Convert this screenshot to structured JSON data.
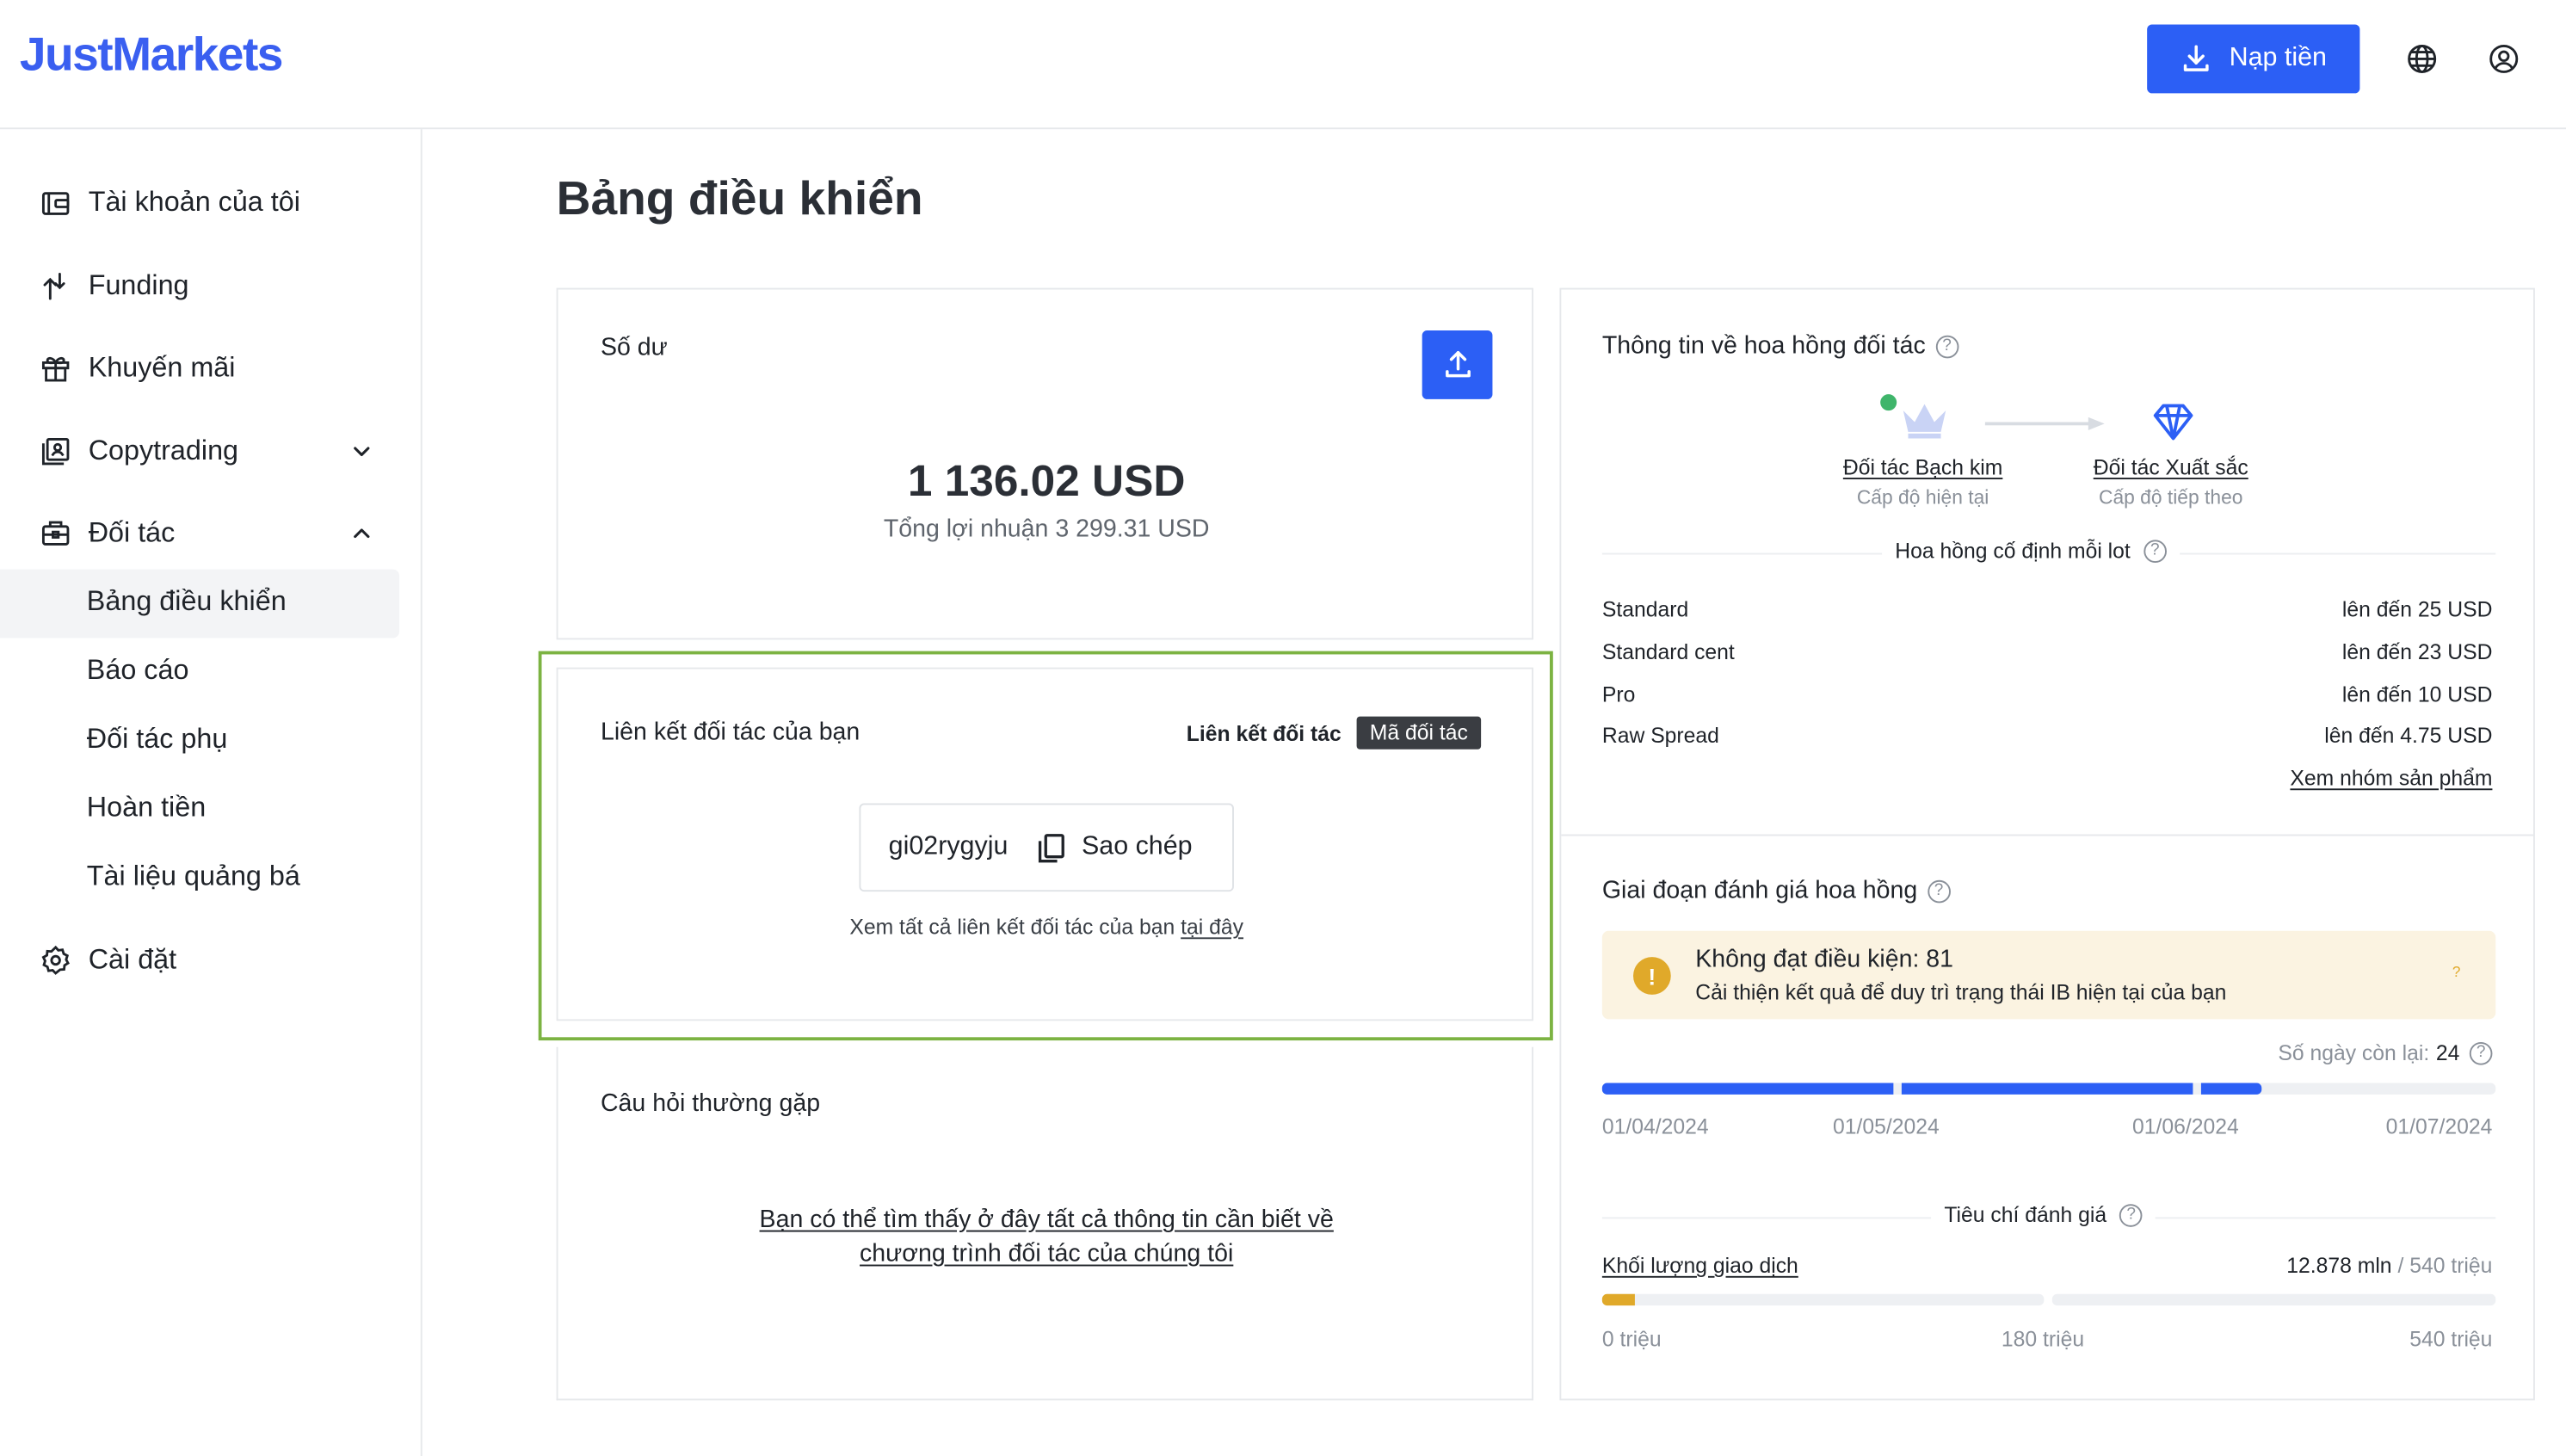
{
  "header": {
    "logo": "JustMarkets",
    "deposit_label": "Nạp tiền"
  },
  "sidebar": {
    "items": [
      {
        "label": "Tài khoản của tôi",
        "icon": "wallet-icon"
      },
      {
        "label": "Funding",
        "icon": "funding-icon"
      },
      {
        "label": "Khuyến mãi",
        "icon": "gift-icon"
      },
      {
        "label": "Copytrading",
        "icon": "copytrading-icon"
      },
      {
        "label": "Đối tác",
        "icon": "briefcase-icon"
      },
      {
        "label": "Cài đặt",
        "icon": "gear-icon"
      }
    ],
    "partner_sub": [
      "Bảng điều khiển",
      "Báo cáo",
      "Đối tác phụ",
      "Hoàn tiền",
      "Tài liệu quảng bá"
    ]
  },
  "page": {
    "title": "Bảng điều khiển"
  },
  "balance": {
    "label": "Số dư",
    "amount": "1 136.02 USD",
    "total_profit": "Tổng lợi nhuận 3 299.31 USD"
  },
  "partner_link": {
    "title": "Liên kết đối tác của bạn",
    "toggle_link": "Liên kết đối tác",
    "toggle_code": "Mã đối tác",
    "code": "gi02rygyju",
    "copy_label": "Sao chép",
    "see_all_prefix": "Xem tất cả liên kết đối tác của bạn",
    "see_all_link": "tại đây"
  },
  "faq": {
    "title": "Câu hỏi thường gặp",
    "line1": "Bạn có thể tìm thấy ở đây tất cả thông tin cần biết về",
    "line2": "chương trình đối tác của chúng tôi"
  },
  "commission": {
    "title": "Thông tin về hoa hồng đối tác",
    "current_level": "Đối tác Bạch kim",
    "current_caption": "Cấp độ hiện tại",
    "next_level": "Đối tác Xuất sắc",
    "next_caption": "Cấp độ tiếp theo",
    "fixed_title": "Hoa hồng cố định mỗi lot",
    "rows": [
      {
        "name": "Standard",
        "value": "lên đến 25 USD"
      },
      {
        "name": "Standard cent",
        "value": "lên đến 23 USD"
      },
      {
        "name": "Pro",
        "value": "lên đến 10 USD"
      },
      {
        "name": "Raw Spread",
        "value": "lên đến 4.75 USD"
      }
    ],
    "view_group": "Xem nhóm sản phẩm"
  },
  "evaluation": {
    "title": "Giai đoạn đánh giá hoa hồng",
    "alert_title": "Không đạt điều kiện: 81",
    "alert_sub": "Cải thiện kết quả để duy trì trạng thái IB hiện tại của bạn",
    "days_left_label": "Số ngày còn lại:",
    "days_left_value": "24",
    "dates": [
      "01/04/2024",
      "01/05/2024",
      "01/06/2024",
      "01/07/2024"
    ],
    "criteria_title": "Tiêu chí đánh giá",
    "volume_label": "Khối lượng giao dịch",
    "volume_value": "12.878 mln",
    "volume_max": "/ 540 triệu",
    "volume_progress": 0.024,
    "scale": [
      "0 triệu",
      "180 triệu",
      "540 triệu"
    ]
  },
  "colors": {
    "accent": "#2c5ff5",
    "warning_bg": "#fbf3e1",
    "warning_icon": "#e0a92a",
    "highlight_border": "#7cb342"
  }
}
